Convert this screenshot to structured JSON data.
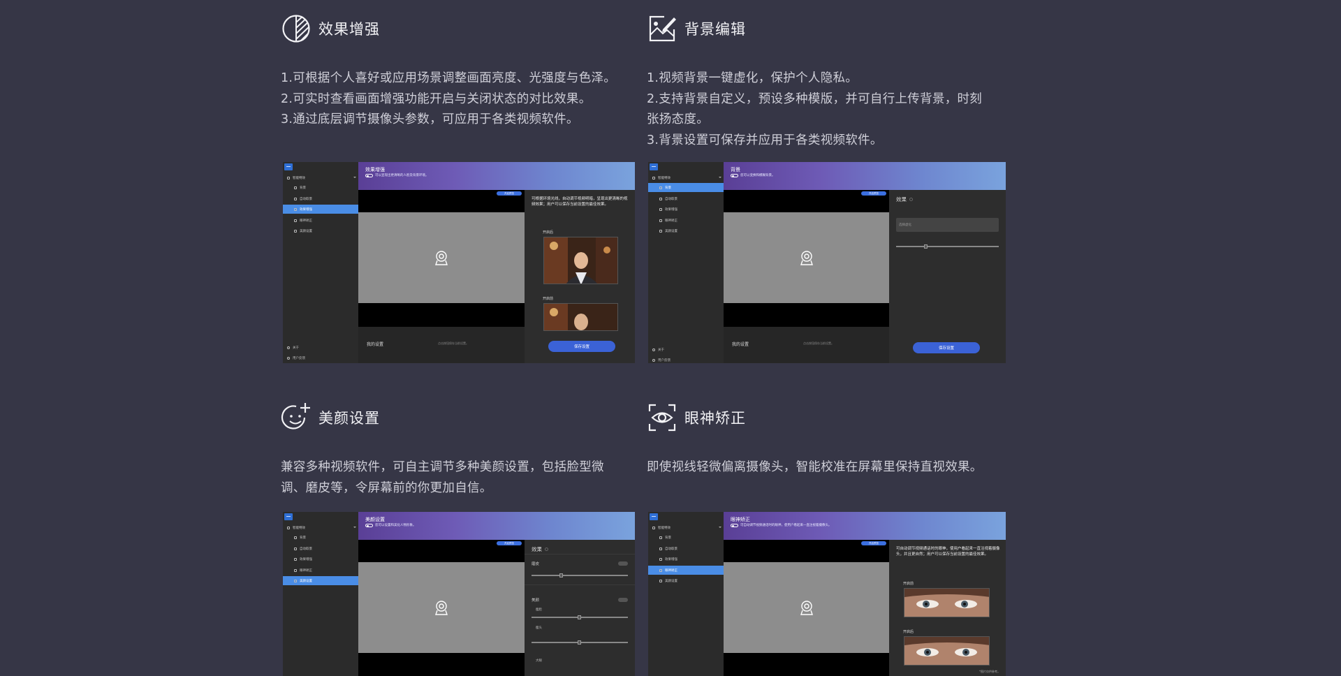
{
  "sections": {
    "enhance": {
      "title": "效果增强",
      "lines": [
        "1.可根据个人喜好或应用场景调整画面亮度、光强度与色泽。",
        "2.可实时查看画面增强功能开启与关闭状态的对比效果。",
        "3.通过底层调节摄像头参数，可应用于各类视频软件。"
      ],
      "icon": "contrast-icon"
    },
    "background": {
      "title": "背景编辑",
      "lines": [
        "1.视频背景一键虚化，保护个人隐私。",
        "2.支持背景自定义，预设多种模版，并可自行上传背景，时刻",
        "张扬态度。",
        "3.背景设置可保存并应用于各类视频软件。"
      ],
      "icon": "image-edit-icon"
    },
    "beauty": {
      "title": "美颜设置",
      "lines": [
        "兼容多种视频软件，可自主调节多种美颜设置，包括脸型微",
        "调、磨皮等，令屏幕前的你更加自信。"
      ],
      "icon": "smile-plus-icon"
    },
    "eye": {
      "title": "眼神矫正",
      "lines": [
        "即使视线轻微偏离摄像头，智能校准在屏幕里保持直视效果。"
      ],
      "icon": "eye-focus-icon"
    }
  },
  "app": {
    "sidebar_group": "智能特效",
    "items": [
      "背景",
      "自动取景",
      "效果增强",
      "眼神矫正",
      "美颜设置"
    ],
    "about": "关于",
    "feedback": "用户反馈",
    "pill": "开启预览",
    "my_settings": "我的设置",
    "settings_hint": "点击按钮保存当前设置。",
    "save": "保存设置",
    "effect_label": "效果"
  },
  "mocks": {
    "enhance": {
      "banner_title": "效果增强",
      "banner_sub": "可以显现出更清晰的人脸及背景环境。",
      "panel_text": "可根据环境光线，自动调节视频明暗，呈现出更清晰的视频效果；用户可以保存当前设置的最佳效果。",
      "after": "开启后",
      "before": "开启前"
    },
    "background": {
      "banner_title": "背景",
      "banner_sub": "您可以变换和模糊背景。",
      "select_placeholder": "选择虚化"
    },
    "beauty": {
      "banner_title": "美颜设置",
      "banner_sub": "您可以设置和美化人物形象。",
      "skin": "磨皮",
      "beauty": "美颜",
      "thin_face": "瘦脸",
      "slim": "瘦头",
      "big_eyes": "大眼"
    },
    "eye": {
      "banner_title": "眼神矫正",
      "banner_sub": "可自动调节视频通话时的眼神，使用户看起来一直注视着摄像头。",
      "panel_text": "可自动调节视频通话时的眼神，使用户看起来一直注视着摄像头，并且更自然；用户可以保存当前设置的最佳效果。",
      "before": "开启前",
      "after": "开启后",
      "footnote": "*图片仅供参考。"
    }
  }
}
